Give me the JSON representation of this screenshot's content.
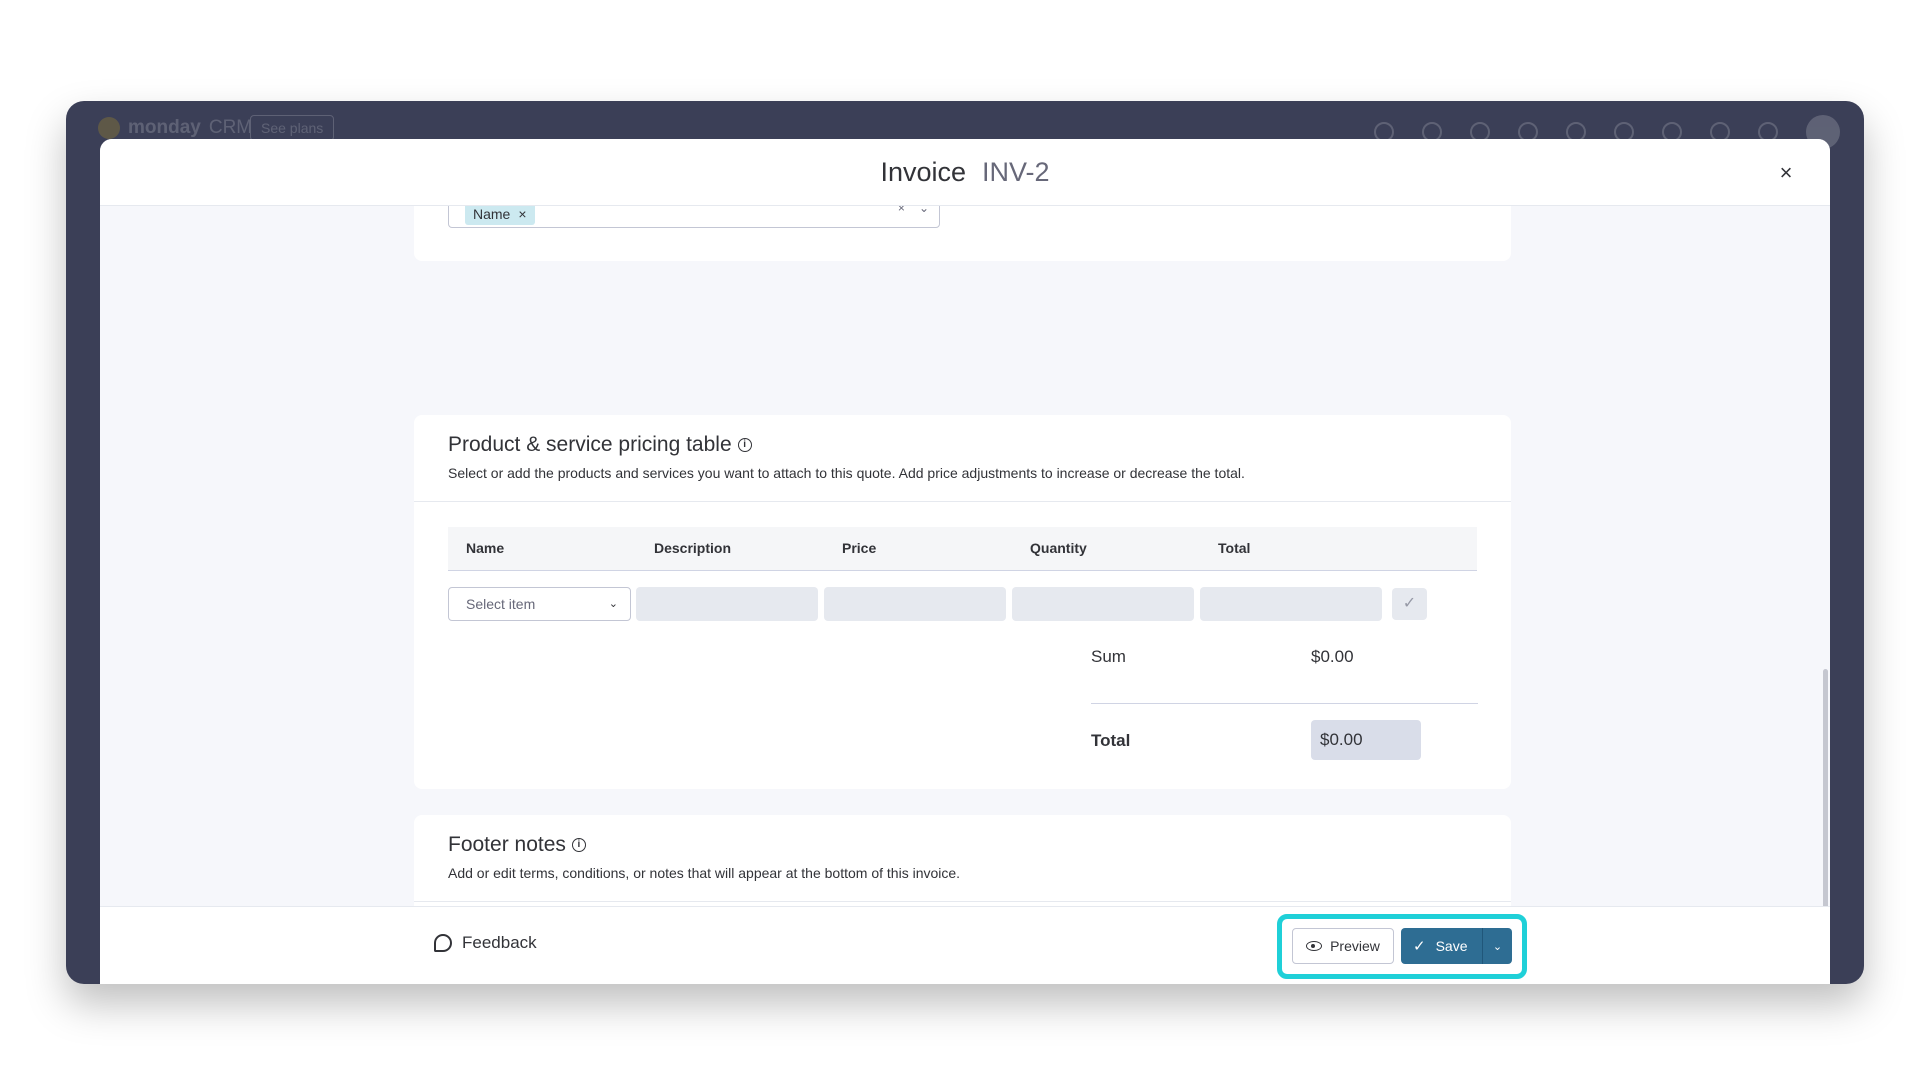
{
  "app": {
    "logo_text": "monday",
    "logo_suffix": "CRM",
    "see_plans": "See plans"
  },
  "modal": {
    "title": "Invoice",
    "subtitle": "INV-2",
    "close_label": "×"
  },
  "top_card": {
    "chip_label": "Name",
    "chip_remove": "×",
    "clear_icon": "×",
    "chevron": "⌄"
  },
  "pricing": {
    "title": "Product & service pricing table",
    "info_icon": "i",
    "description": "Select or add the products and services you want to attach to this quote. Add price adjustments to increase or decrease the total.",
    "columns": [
      "Name",
      "Description",
      "Price",
      "Quantity",
      "Total"
    ],
    "select_placeholder": "Select item",
    "select_chevron": "⌄",
    "confirm_icon": "✓",
    "sum_label": "Sum",
    "sum_value": "$0.00",
    "total_label": "Total",
    "total_value": "$0.00"
  },
  "footer_notes": {
    "title": "Footer notes",
    "info_icon": "i",
    "description": "Add or edit terms, conditions, or notes that will appear at the bottom of this invoice.",
    "value": ""
  },
  "bottom_bar": {
    "feedback_label": "Feedback",
    "preview_label": "Preview",
    "save_label": "Save",
    "save_check": "✓",
    "save_chevron": "⌄"
  },
  "colors": {
    "primary": "#2e6d93",
    "highlight": "#1fd0d8",
    "chip": "#cce9f0",
    "frame": "#3b3f57"
  }
}
